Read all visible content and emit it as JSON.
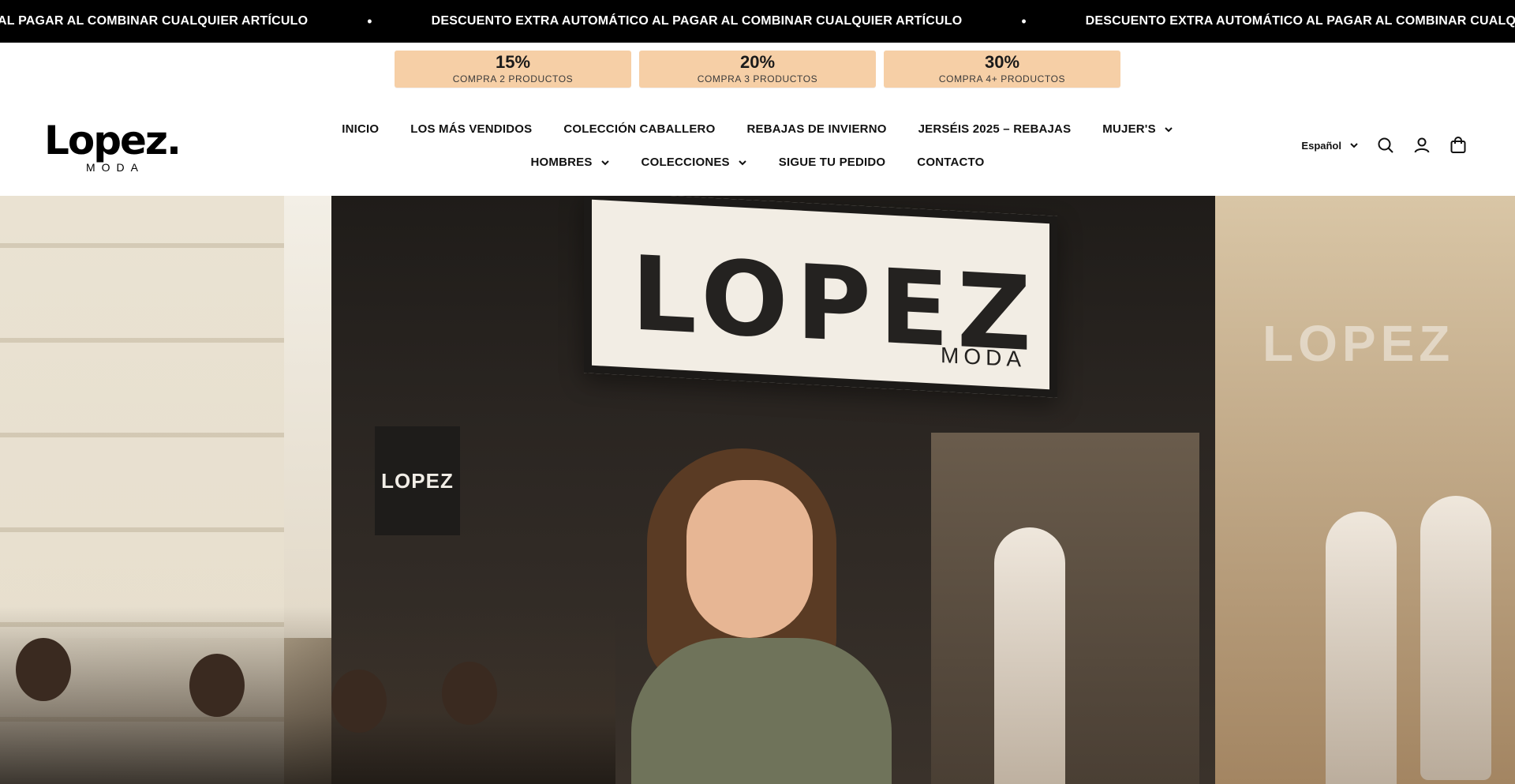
{
  "announcement": {
    "message": "DESCUENTO EXTRA AUTOMÁTICO AL PAGAR AL COMBINAR CUALQUIER ARTÍCULO",
    "separator": "•",
    "partial_start": "OMÁTICO AL PAGAR AL COMBINAR CUALQUIER ARTÍCULO"
  },
  "tiers": [
    {
      "percent": "15%",
      "label": "COMPRA 2 PRODUCTOS"
    },
    {
      "percent": "20%",
      "label": "COMPRA 3 PRODUCTOS"
    },
    {
      "percent": "30%",
      "label": "COMPRA 4+ PRODUCTOS"
    }
  ],
  "logo": {
    "main": "Lopez.",
    "sub": "MODA"
  },
  "nav": {
    "row1": [
      {
        "label": "INICIO",
        "dropdown": false
      },
      {
        "label": "LOS MÁS VENDIDOS",
        "dropdown": false
      },
      {
        "label": "COLECCIÓN CABALLERO",
        "dropdown": false
      },
      {
        "label": "REBAJAS DE INVIERNO",
        "dropdown": false
      },
      {
        "label": "JERSÉIS 2025 – REBAJAS",
        "dropdown": false
      },
      {
        "label": "MUJER'S",
        "dropdown": true
      }
    ],
    "row2": [
      {
        "label": "HOMBRES",
        "dropdown": true
      },
      {
        "label": "COLECCIONES",
        "dropdown": true
      },
      {
        "label": "SIGUE TU PEDIDO",
        "dropdown": false
      },
      {
        "label": "CONTACTO",
        "dropdown": false
      }
    ]
  },
  "tools": {
    "language": "Español",
    "icons": [
      "search-icon",
      "account-icon",
      "cart-icon"
    ]
  },
  "hero": {
    "store_sign": "LOPEZ",
    "store_sign_sub": "MODA",
    "small_sign": "LOPEZ",
    "window_reflection": "LOPEZ"
  },
  "colors": {
    "announcement_bg": "#000000",
    "tier_bg": "#f6cfa6"
  }
}
